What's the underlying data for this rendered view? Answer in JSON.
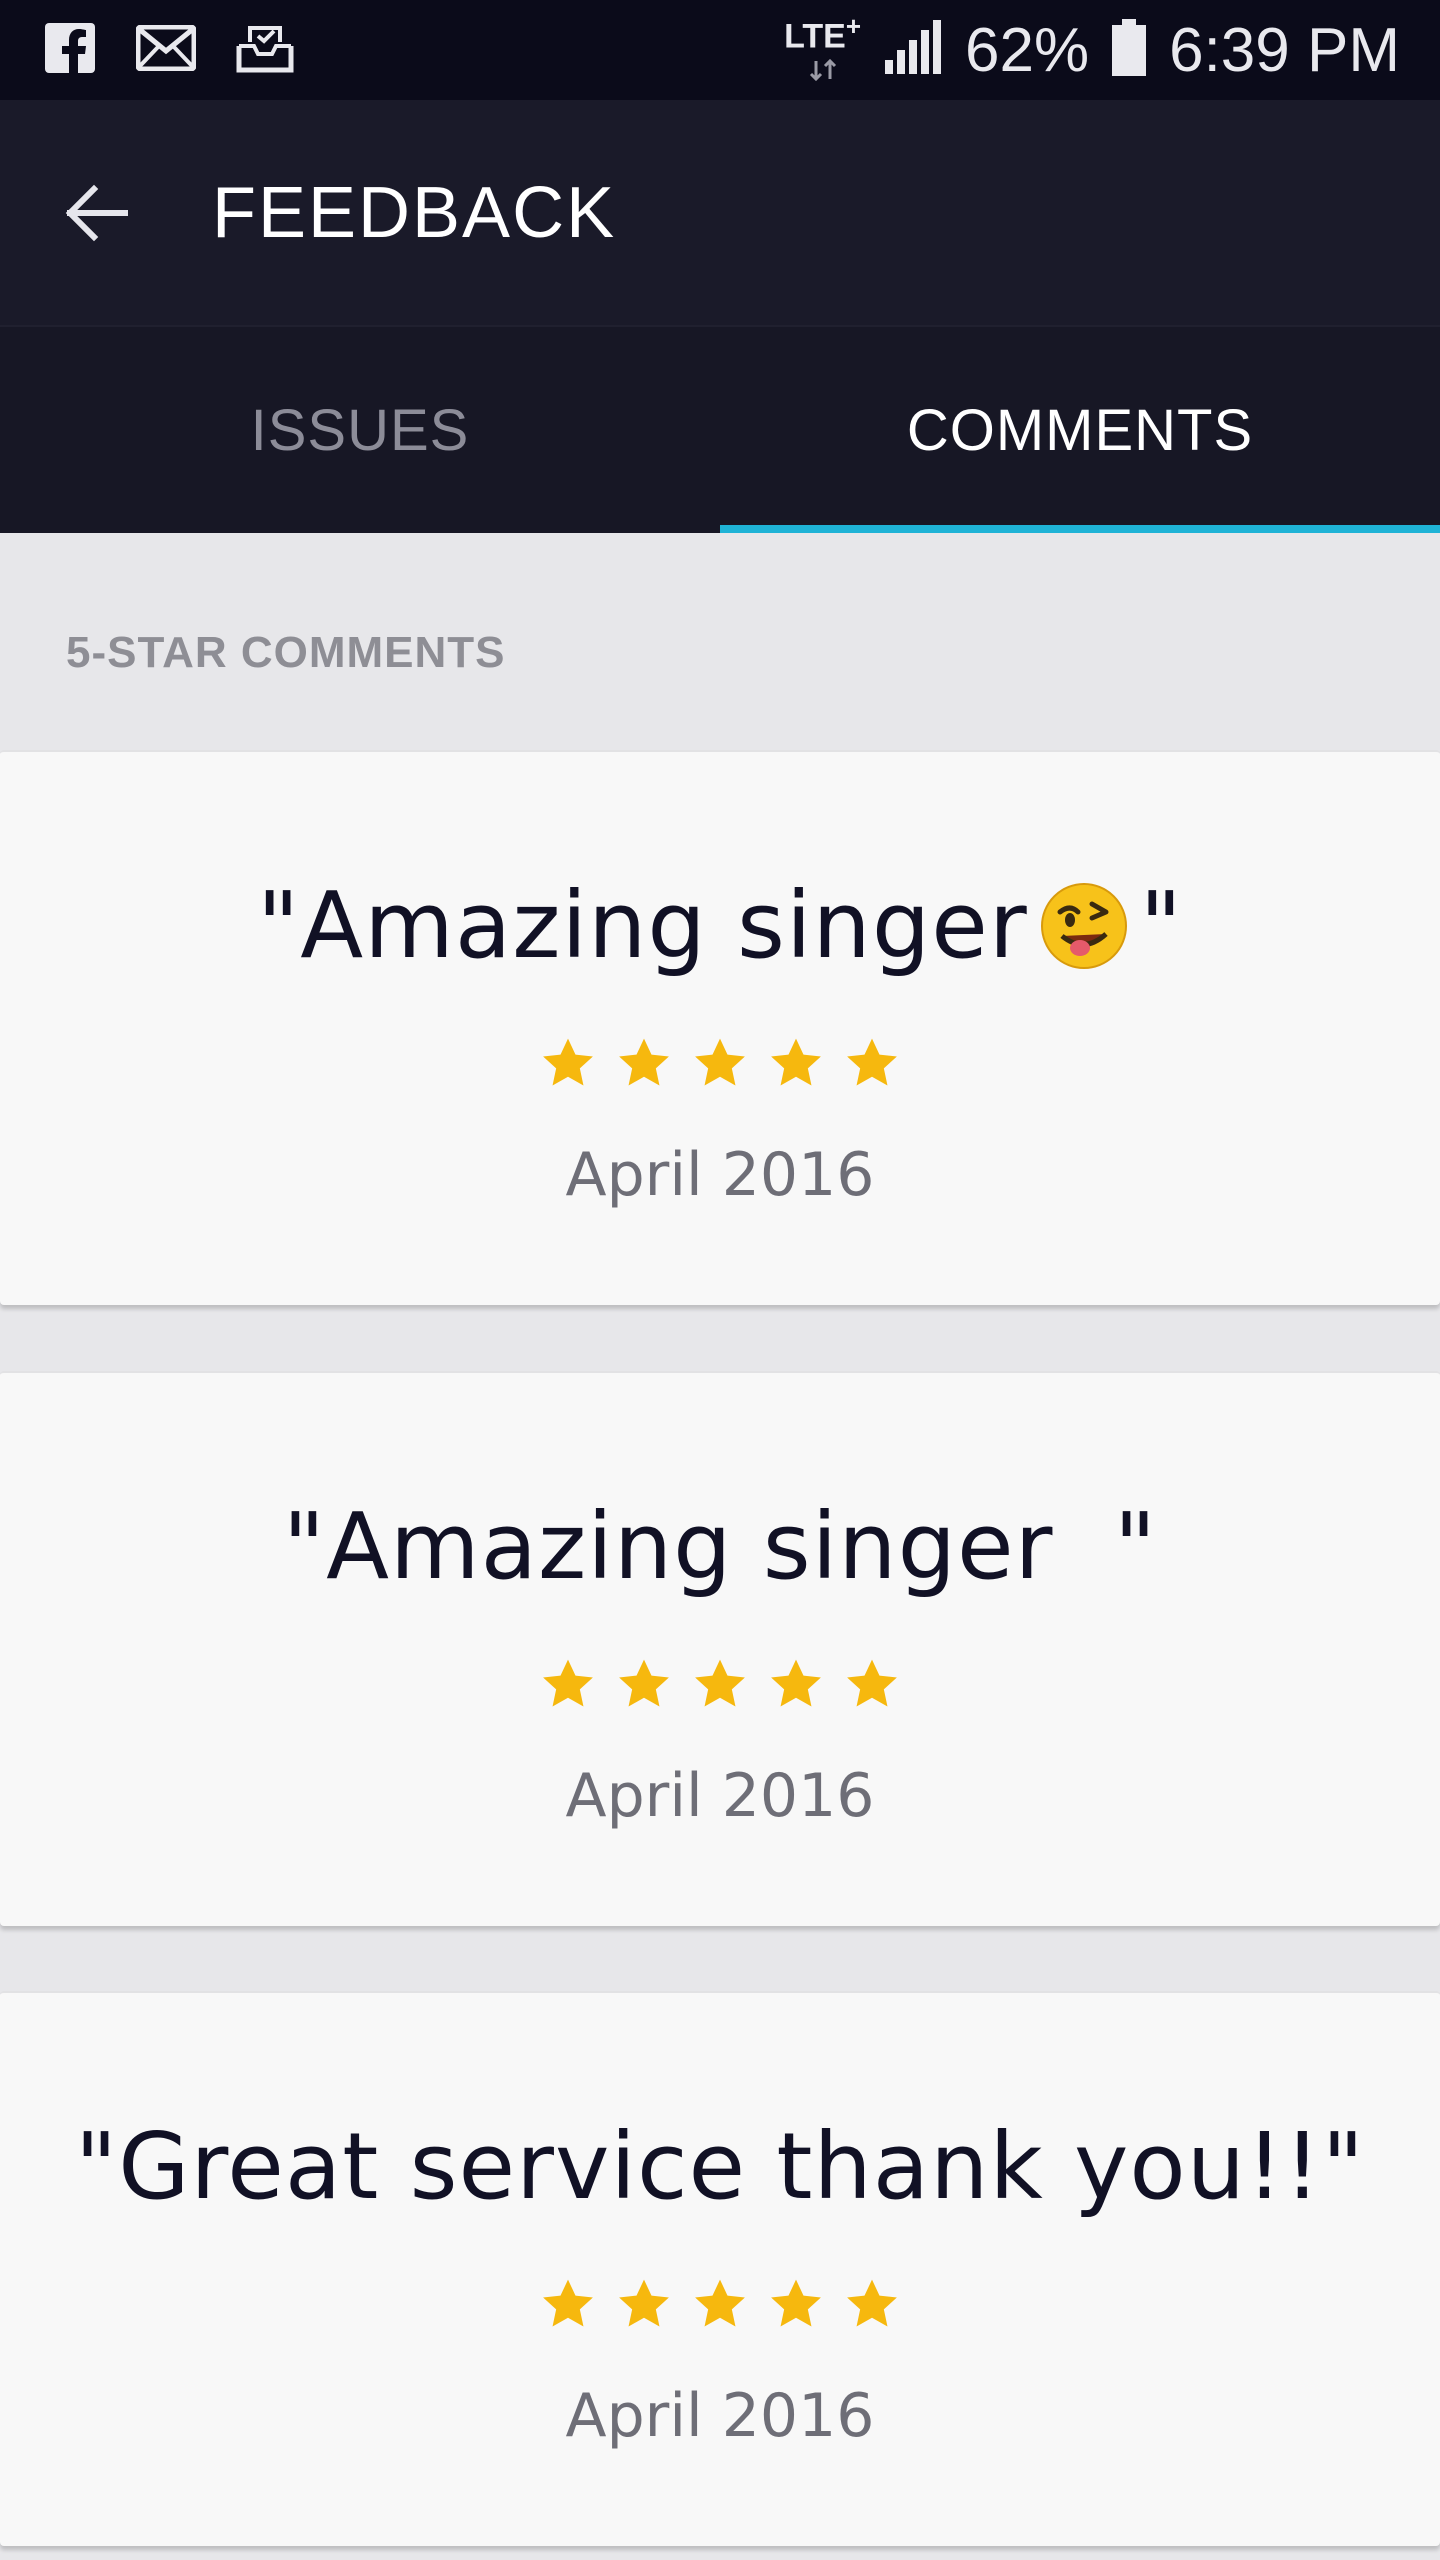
{
  "status_bar": {
    "network": "LTE",
    "network_plus": "+",
    "battery": "62%",
    "time": "6:39 PM",
    "notification_icons": [
      "facebook-icon",
      "mail-icon",
      "inbox-icon"
    ]
  },
  "app_bar": {
    "title": "FEEDBACK"
  },
  "tabs": [
    {
      "label": "ISSUES",
      "selected": false
    },
    {
      "label": "COMMENTS",
      "selected": true
    }
  ],
  "section": {
    "title": "5-STAR COMMENTS"
  },
  "comments": [
    {
      "open_quote": "\"Amazing singer",
      "close_quote": "\"",
      "emoji": "winking-face-tongue-emoji",
      "rating": 5,
      "date": "April 2016"
    },
    {
      "text": "\"Amazing singer  \"",
      "rating": 5,
      "date": "April 2016"
    },
    {
      "text": "\"Great service thank you!!\"",
      "rating": 5,
      "date": "April 2016"
    }
  ],
  "colors": {
    "accent": "#1fb3d6",
    "star": "#f6b80e",
    "app_bar": "#1a1a29",
    "status_bar": "#0b0b1a",
    "background": "#e7e7ea"
  }
}
